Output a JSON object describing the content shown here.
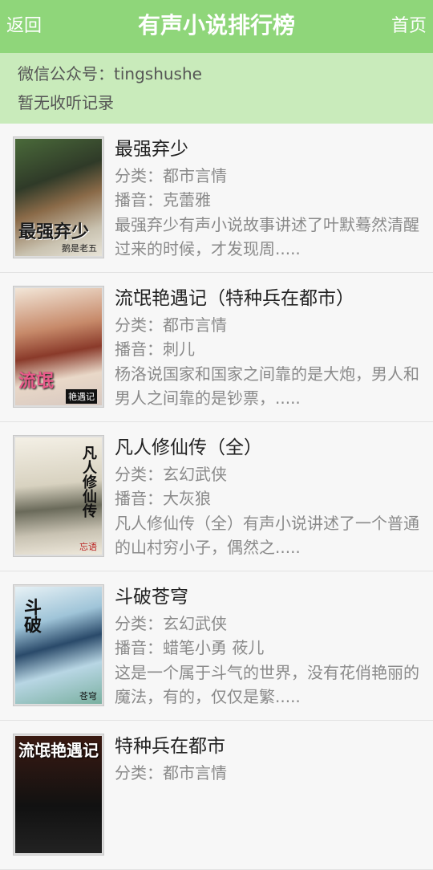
{
  "header": {
    "back_label": "返回",
    "title": "有声小说排行榜",
    "home_label": "首页",
    "bg_color": "#8fd67a"
  },
  "info": {
    "wechat": "微信公众号：tingshushe",
    "history": "暂无收听记录",
    "bg_color": "#c9ebbb"
  },
  "books": [
    {
      "title": "最强弃少",
      "category": "分类：都市言情",
      "narrator": "播音：克蕾雅",
      "description": "最强弃少有声小说故事讲述了叶默蓦然清醒过来的时候，才发现周.....",
      "cover_text": "最强弃少",
      "cover_sub": "鹅是老五"
    },
    {
      "title": "流氓艳遇记（特种兵在都市）",
      "category": "分类：都市言情",
      "narrator": "播音：刺儿",
      "description": "杨洛说国家和国家之间靠的是大炮，男人和男人之间靠的是钞票，.....",
      "cover_text": "流氓",
      "cover_sub": "艳遇记"
    },
    {
      "title": "凡人修仙传（全）",
      "category": "分类：玄幻武侠",
      "narrator": "播音：大灰狼",
      "description": "凡人修仙传（全）有声小说讲述了一个普通的山村穷小子，偶然之.....",
      "cover_text": "凡人修仙传",
      "cover_sub": "忘语"
    },
    {
      "title": "斗破苍穹",
      "category": "分类：玄幻武侠",
      "narrator": "播音：蜡笔小勇 莜儿",
      "description": "这是一个属于斗气的世界，没有花俏艳丽的魔法，有的，仅仅是繁.....",
      "cover_text": "斗破",
      "cover_sub": "苍穹"
    },
    {
      "title": "特种兵在都市",
      "category": "分类：都市言情",
      "narrator": "",
      "description": "",
      "cover_text": "流氓艳遇记",
      "cover_sub": ""
    }
  ]
}
